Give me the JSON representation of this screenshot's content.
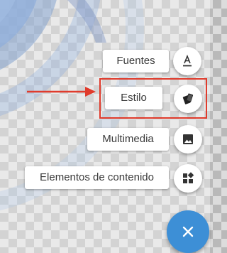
{
  "speed_dial": {
    "items": [
      {
        "label": "Fuentes",
        "icon": "text-format-icon"
      },
      {
        "label": "Estilo",
        "icon": "style-icon"
      },
      {
        "label": "Multimedia",
        "icon": "image-icon"
      },
      {
        "label": "Elementos de contenido",
        "icon": "widgets-icon"
      }
    ],
    "close_icon": "close-icon"
  },
  "annotation": {
    "arrow_color": "#e03b2c",
    "highlight_color": "#e03b2c",
    "highlighted_item": "Estilo"
  },
  "colors": {
    "fab": "#3d8fd6",
    "label_bg": "#ffffff",
    "text": "#3a3a3a"
  }
}
